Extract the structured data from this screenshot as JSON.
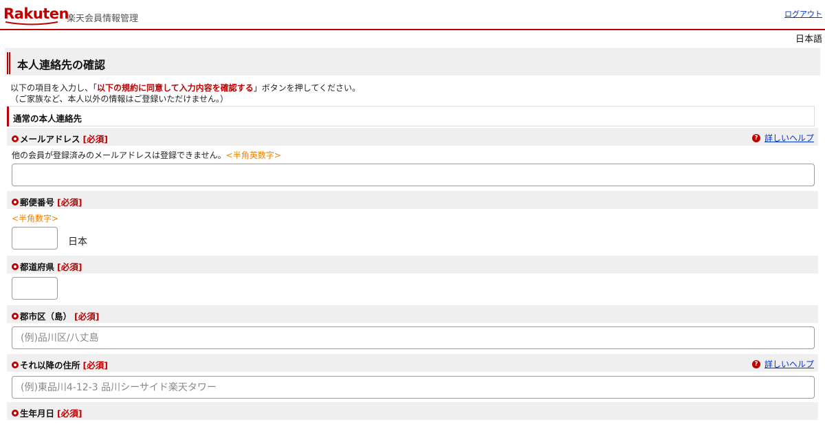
{
  "header": {
    "logo": "Rakuten",
    "site_name": "楽天会員情報管理",
    "logout": "ログアウト"
  },
  "language": "日本語",
  "page": {
    "title": "本人連絡先の確認",
    "intro_pre": "以下の項目を入力し、「",
    "intro_em": "以下の規約に同意して入力内容を確認する",
    "intro_post": "」ボタンを押してください。",
    "intro_line2": "（ご家族など、本人以外の情報はご登録いただけません。）"
  },
  "section": {
    "title": "通常の本人連絡先"
  },
  "required_label": "[必須]",
  "help_label": "詳しいヘルプ",
  "fields": {
    "email": {
      "label": "メールアドレス",
      "note": "他の会員が登録済みのメールアドレスは登録できません。",
      "hint": "<半角英数字>",
      "value": ""
    },
    "postal": {
      "label": "郵便番号",
      "hint": "<半角数字>",
      "value": "",
      "country": "日本"
    },
    "prefecture": {
      "label": "都道府県",
      "value": ""
    },
    "city": {
      "label": "郡市区（島）",
      "placeholder": "(例)品川区/八丈島"
    },
    "address": {
      "label": "それ以降の住所",
      "placeholder": "(例)東品川4-12-3 品川シーサイド楽天タワー"
    },
    "birthdate": {
      "label": "生年月日"
    }
  },
  "colors": {
    "brand": "#bf0000",
    "hint": "#f08000",
    "link": "#0033cc"
  }
}
